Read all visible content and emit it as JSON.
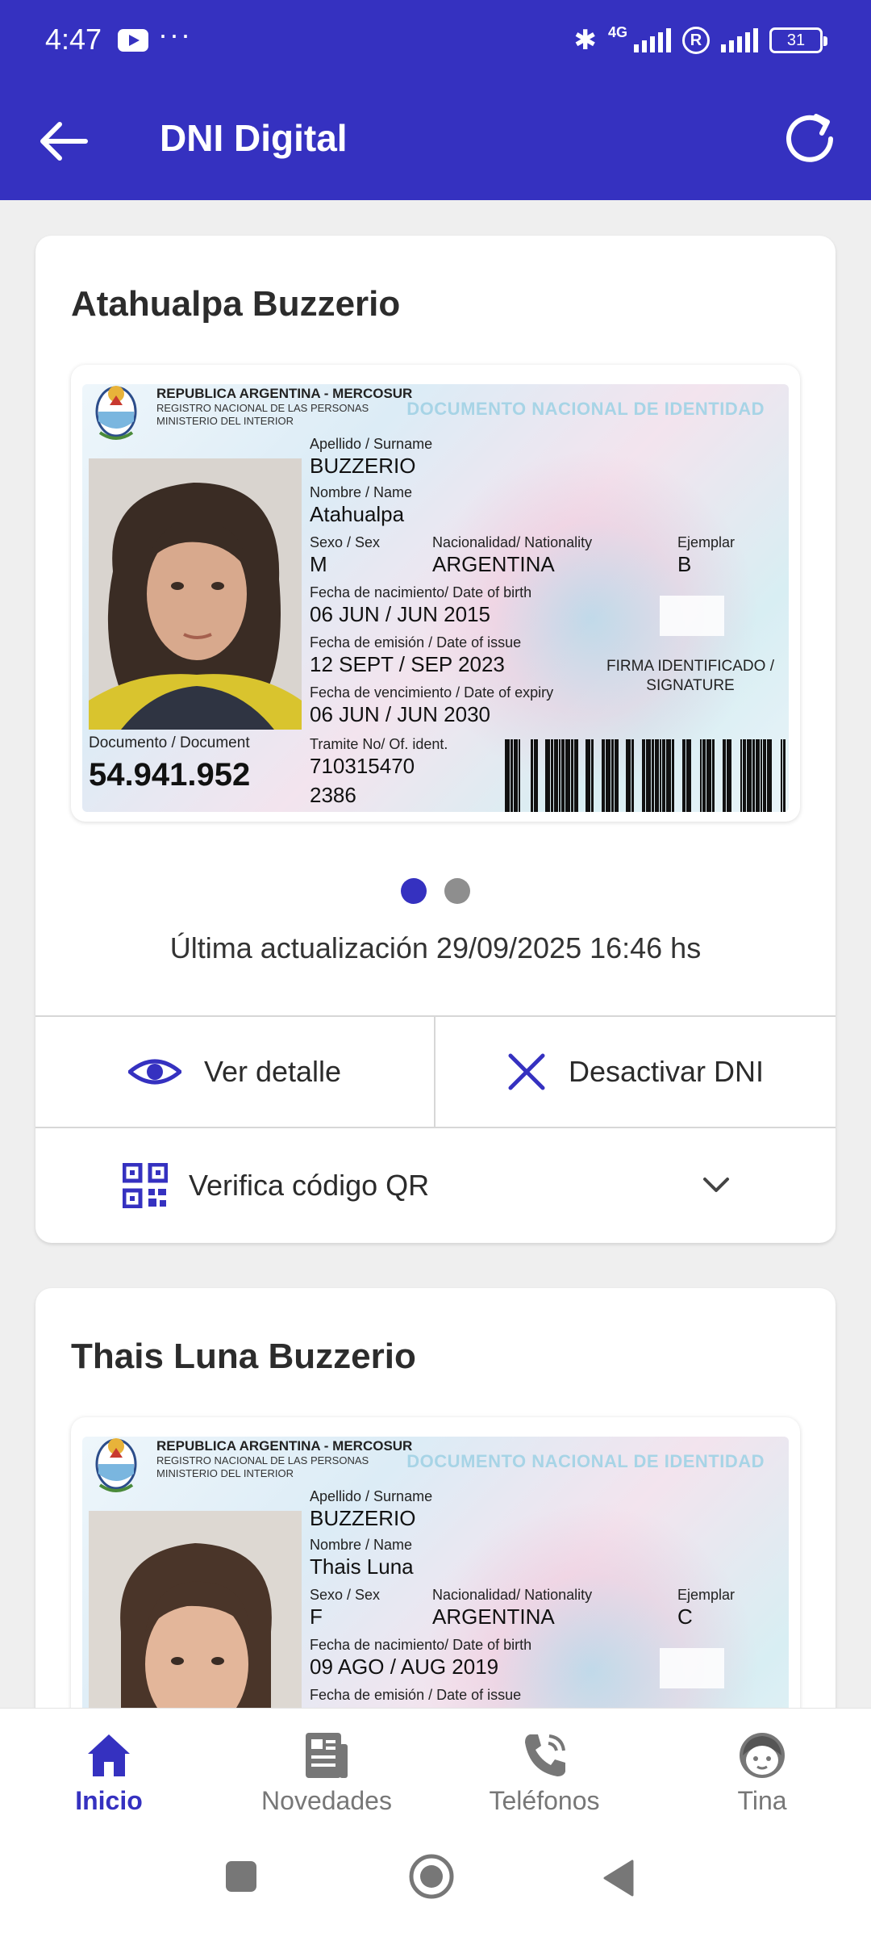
{
  "status_bar": {
    "time": "4:47",
    "dots": "···",
    "network": "4G",
    "battery": "31"
  },
  "app_bar": {
    "title": "DNI Digital"
  },
  "dni_header": {
    "line1": "REPUBLICA ARGENTINA  -  MERCOSUR",
    "line2": "REGISTRO NACIONAL DE LAS PERSONAS",
    "line3": "MINISTERIO DEL INTERIOR",
    "doc_title": "DOCUMENTO NACIONAL DE IDENTIDAD"
  },
  "labels": {
    "surname": "Apellido / Surname",
    "name": "Nombre / Name",
    "sex": "Sexo / Sex",
    "nationality": "Nacionalidad/ Nationality",
    "copy": "Ejemplar",
    "birth": "Fecha de nacimiento/ Date of birth",
    "issue": "Fecha de emisión / Date of issue",
    "expiry": "Fecha de vencimiento / Date of expiry",
    "document": "Documento / Document",
    "tramite": "Tramite No/ Of. ident.",
    "signature": "FIRMA IDENTIFICADO / SIGNATURE"
  },
  "cards": [
    {
      "person_name": "Atahualpa Buzzerio",
      "surname": "BUZZERIO",
      "name": "Atahualpa",
      "sex": "M",
      "nationality": "ARGENTINA",
      "copy": "B",
      "birth": "06 JUN / JUN 2015",
      "issue": "12 SEPT / SEP 2023",
      "expiry": "06 JUN / JUN 2030",
      "document": "54.941.952",
      "tramite_1": "710315470",
      "tramite_2": "2386",
      "updated": "Última actualización 29/09/2025 16:46 hs",
      "view_detail": "Ver detalle",
      "deactivate": "Desactivar DNI",
      "verify_qr": "Verifica código QR"
    },
    {
      "person_name": "Thais Luna Buzzerio",
      "surname": "BUZZERIO",
      "name": "Thais Luna",
      "sex": "F",
      "nationality": "ARGENTINA",
      "copy": "C",
      "birth": "09 AGO / AUG 2019"
    }
  ],
  "bottom_nav": [
    {
      "label": "Inicio",
      "icon": "home-icon",
      "active": true
    },
    {
      "label": "Novedades",
      "icon": "news-icon",
      "active": false
    },
    {
      "label": "Teléfonos",
      "icon": "phone-icon",
      "active": false
    },
    {
      "label": "Tina",
      "icon": "tina-face-icon",
      "active": false
    }
  ],
  "colors": {
    "brand": "#3531c0",
    "inactive": "#777777",
    "background": "#efefef"
  }
}
